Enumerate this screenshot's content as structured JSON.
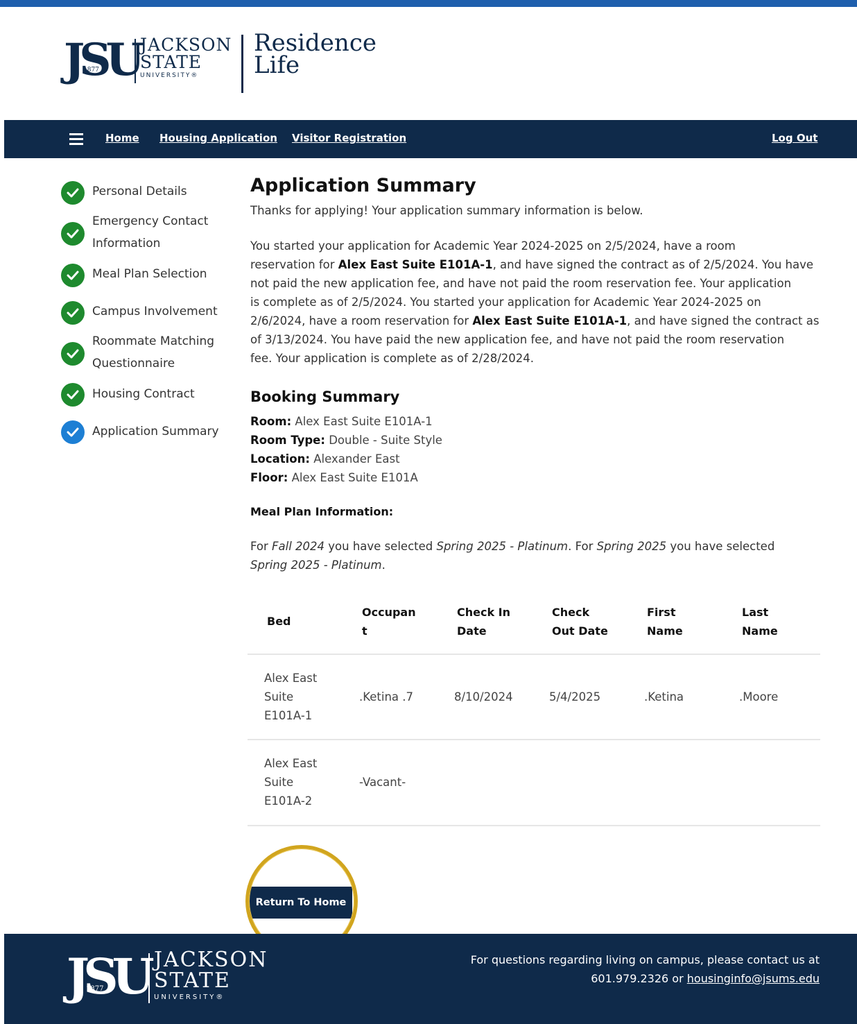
{
  "header": {
    "logo_jsu": "JSU",
    "logo_year": "1877",
    "logo_line1": "JACKSON",
    "logo_line2": "STATE",
    "logo_line3": "UNIVERSITY®",
    "site_line1": "Residence",
    "site_line2": "Life"
  },
  "nav": {
    "home": "Home",
    "housing_application": "Housing Application",
    "visitor_registration": "Visitor Registration",
    "log_out": "Log Out"
  },
  "steps": [
    {
      "line1": "Personal Details",
      "line2": "",
      "status": "complete"
    },
    {
      "line1": "Emergency Contact",
      "line2": "Information",
      "status": "complete"
    },
    {
      "line1": "Meal Plan Selection",
      "line2": "",
      "status": "complete"
    },
    {
      "line1": "Campus Involvement",
      "line2": "",
      "status": "complete"
    },
    {
      "line1": "Roommate Matching",
      "line2": "Questionnaire",
      "status": "complete"
    },
    {
      "line1": "Housing Contract",
      "line2": "",
      "status": "complete"
    },
    {
      "line1": "Application Summary",
      "line2": "",
      "status": "current"
    }
  ],
  "summary": {
    "title": "Application Summary",
    "intro": "Thanks for applying! Your application summary information is below.",
    "p1a": "You started your application for Academic Year 2024-2025 on 2/5/2024, have a room",
    "p2a": "reservation for ",
    "p2b": "Alex East Suite E101A-1",
    "p2c": ", and have signed the contract as of 2/5/2024. You have",
    "p3": "not paid the new application fee, and have not paid the room reservation fee. Your application",
    "p4": "is complete as of 2/5/2024. You started your application for Academic Year 2024-2025 on",
    "p5a": "2/6/2024, have a room reservation for ",
    "p5b": "Alex East Suite E101A-1",
    "p5c": ", and have signed the contract as",
    "p6": "of 3/13/2024. You have paid the new application fee, and have not paid the room reservation",
    "p7": "fee. Your application is complete as of 2/28/2024."
  },
  "booking": {
    "title": "Booking Summary",
    "room_label": "Room:",
    "room_value": " Alex East Suite E101A-1",
    "type_label": "Room Type:",
    "type_value": " Double - Suite Style",
    "location_label": "Location:",
    "location_value": " Alexander East",
    "floor_label": "Floor:",
    "floor_value": " Alex East Suite E101A"
  },
  "meal": {
    "title": "Meal Plan Information:",
    "l1a": "For ",
    "l1b": "Fall 2024",
    "l1c": " you have selected ",
    "l1d": "Spring 2025 - Platinum",
    "l1e": ". For ",
    "l1f": "Spring 2025",
    "l1g": " you have selected",
    "l2a": "Spring 2025 - Platinum",
    "l2b": "."
  },
  "table": {
    "headers": [
      {
        "l1": "Bed",
        "l2": ""
      },
      {
        "l1": "Occupan",
        "l2": "t"
      },
      {
        "l1": "Check In",
        "l2": "Date"
      },
      {
        "l1": "Check",
        "l2": "Out Date"
      },
      {
        "l1": "First",
        "l2": "Name"
      },
      {
        "l1": "Last",
        "l2": "Name"
      }
    ],
    "rows": [
      {
        "bed1": "Alex East",
        "bed2": "Suite",
        "bed3": "E101A-1",
        "occupant": ".Ketina .7",
        "check_in": "8/10/2024",
        "check_out": "5/4/2025",
        "first": ".Ketina",
        "last": ".Moore"
      },
      {
        "bed1": "Alex East",
        "bed2": "Suite",
        "bed3": "E101A-2",
        "occupant": "-Vacant-",
        "check_in": "",
        "check_out": "",
        "first": "",
        "last": ""
      }
    ]
  },
  "return_button": "Return To Home",
  "footer": {
    "contact_line1": "For questions regarding living on campus, please contact us at",
    "phone": "601.979.2326",
    "or": " or ",
    "email": "housinginfo@jsums.edu"
  },
  "colors": {
    "navy": "#0f2a4a",
    "top_rule": "#1f5fad",
    "complete": "#1e8a2e",
    "current": "#1d7fd4",
    "highlight_circle": "#d1a51e"
  }
}
